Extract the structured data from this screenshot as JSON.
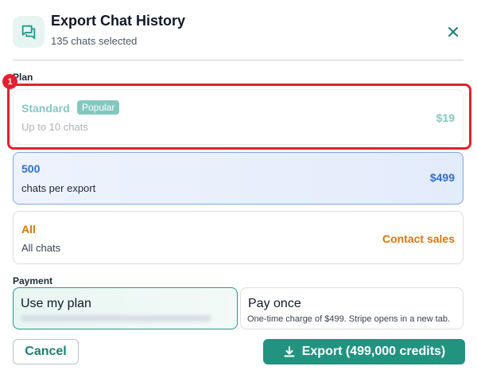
{
  "header": {
    "title": "Export Chat History",
    "subtitle": "135 chats selected",
    "icon": "chat-bubbles-icon",
    "close_icon": "close-icon"
  },
  "plan_section": {
    "label": "Plan",
    "marker": "1",
    "plans": [
      {
        "name": "Standard",
        "badge": "Popular",
        "description": "Up to 10 chats",
        "price": "$19",
        "color": "#1f9c8a"
      },
      {
        "name": "500",
        "description": "chats per export",
        "price": "$499",
        "color": "#2f6fcf",
        "selected": true
      },
      {
        "name": "All",
        "description": "All chats",
        "price": "Contact sales",
        "color": "#d97706"
      }
    ]
  },
  "payment_section": {
    "label": "Payment",
    "options": [
      {
        "title": "Use my plan",
        "selected": true
      },
      {
        "title": "Pay once",
        "note": "One-time charge of $499. Stripe opens in a new tab."
      }
    ]
  },
  "footer": {
    "cancel_label": "Cancel",
    "export_label": "Export (499,000 credits)",
    "export_icon": "download-icon"
  },
  "colors": {
    "accent": "#22937f",
    "highlight": "#e5202e"
  }
}
